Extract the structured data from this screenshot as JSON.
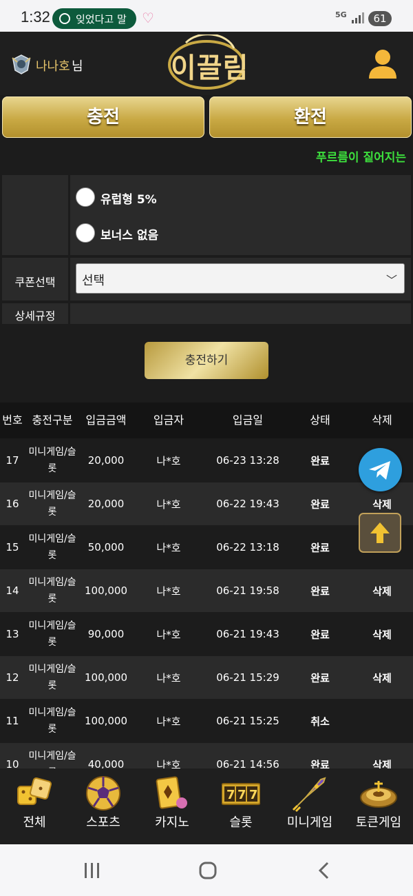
{
  "status_bar": {
    "time": "1:32",
    "notification": "잊었다고 말",
    "network": "5G",
    "battery": "61"
  },
  "header": {
    "username": "나나호",
    "username_suffix": "님",
    "logo": "이끌림"
  },
  "tabs": {
    "charge": "충전",
    "exchange": "환전"
  },
  "marquee": "푸르름이 짙어지는",
  "form": {
    "bonus_options": [
      "유럽형 5%",
      "보너스 없음"
    ],
    "coupon_label": "쿠폰선택",
    "coupon_value": "선택",
    "rules_label": "상세규정",
    "submit_label": "충전하기"
  },
  "table": {
    "headers": [
      "번호",
      "충전구분",
      "입금금액",
      "입금자",
      "입금일",
      "상태",
      "삭제"
    ],
    "rows": [
      {
        "no": "17",
        "type": "미니게임/슬롯",
        "amount": "20,000",
        "depositor": "나*호",
        "date": "06-23 13:28",
        "status": "완료",
        "delete": ""
      },
      {
        "no": "16",
        "type": "미니게임/슬롯",
        "amount": "20,000",
        "depositor": "나*호",
        "date": "06-22 19:43",
        "status": "완료",
        "delete": "삭제"
      },
      {
        "no": "15",
        "type": "미니게임/슬롯",
        "amount": "50,000",
        "depositor": "나*호",
        "date": "06-22 13:18",
        "status": "완료",
        "delete": ""
      },
      {
        "no": "14",
        "type": "미니게임/슬롯",
        "amount": "100,000",
        "depositor": "나*호",
        "date": "06-21 19:58",
        "status": "완료",
        "delete": "삭제"
      },
      {
        "no": "13",
        "type": "미니게임/슬롯",
        "amount": "90,000",
        "depositor": "나*호",
        "date": "06-21 19:43",
        "status": "완료",
        "delete": "삭제"
      },
      {
        "no": "12",
        "type": "미니게임/슬롯",
        "amount": "100,000",
        "depositor": "나*호",
        "date": "06-21 15:29",
        "status": "완료",
        "delete": "삭제"
      },
      {
        "no": "11",
        "type": "미니게임/슬롯",
        "amount": "100,000",
        "depositor": "나*호",
        "date": "06-21 15:25",
        "status": "취소",
        "delete": ""
      },
      {
        "no": "10",
        "type": "미니게임/슬롯",
        "amount": "40,000",
        "depositor": "나*호",
        "date": "06-21 14:56",
        "status": "완료",
        "delete": "삭제"
      }
    ]
  },
  "bottom_nav": [
    {
      "label": "전체",
      "icon": "dice-icon"
    },
    {
      "label": "스포츠",
      "icon": "soccer-ball-icon"
    },
    {
      "label": "카지노",
      "icon": "card-icon"
    },
    {
      "label": "슬롯",
      "icon": "slot-777-icon"
    },
    {
      "label": "미니게임",
      "icon": "rocket-icon"
    },
    {
      "label": "토큰게임",
      "icon": "roulette-icon"
    }
  ],
  "colors": {
    "gold": "#c9a944",
    "marquee": "#3de03d",
    "background": "#1c1c1c"
  }
}
